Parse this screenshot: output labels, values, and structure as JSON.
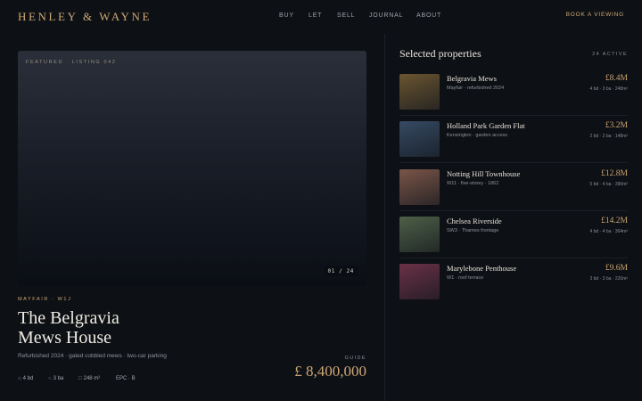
{
  "brand": {
    "logo": "HENLEY & WAYNE"
  },
  "nav": {
    "items": [
      "BUY",
      "LET",
      "SELL",
      "JOURNAL",
      "ABOUT"
    ],
    "cta": "BOOK A VIEWING"
  },
  "featured": {
    "tag": "FEATURED · LISTING 042",
    "counter": "01 / 24",
    "locale": "MAYFAIR · W1J",
    "title_line1": "The Belgravia",
    "title_line2": "Mews House",
    "subtitle": "Refurbished 2024 · gated cobbled mews · two-car parking",
    "guide_label": "GUIDE",
    "price": "£ 8,400,000",
    "specs": {
      "beds": "4 bd",
      "baths": "3 ba",
      "area": "248 m²",
      "epc": "EPC · B"
    }
  },
  "sidebar": {
    "title": "Selected properties",
    "count": "24 ACTIVE",
    "listings": [
      {
        "name": "Belgravia Mews",
        "desc": "Mayfair · refurbished 2024",
        "price": "£8.4M",
        "specs": "4 bd · 3 ba · 248m²",
        "thumb_color": "#6a5530"
      },
      {
        "name": "Holland Park Garden Flat",
        "desc": "Kensington · garden access",
        "price": "£3.2M",
        "specs": "2 bd · 2 ba · 148m²",
        "thumb_color": "#354a63"
      },
      {
        "name": "Notting Hill Townhouse",
        "desc": "W11 · five-storey · 1862",
        "price": "£12.8M",
        "specs": "5 bd · 4 ba · 390m²",
        "thumb_color": "#7a5548"
      },
      {
        "name": "Chelsea Riverside",
        "desc": "SW3 · Thames frontage",
        "price": "£14.2M",
        "specs": "4 bd · 4 ba · 304m²",
        "thumb_color": "#4d6047"
      },
      {
        "name": "Marylebone Penthouse",
        "desc": "W1 · roof terrace",
        "price": "£9.6M",
        "specs": "3 bd · 3 ba · 220m²",
        "thumb_color": "#6a3146"
      }
    ]
  },
  "colors": {
    "accent": "#cfa877",
    "background": "#0d1014",
    "text": "#e8e4dc",
    "muted": "#8f949c"
  },
  "icons": {
    "beds": "bed-icon",
    "baths": "bath-icon",
    "area": "area-icon"
  }
}
